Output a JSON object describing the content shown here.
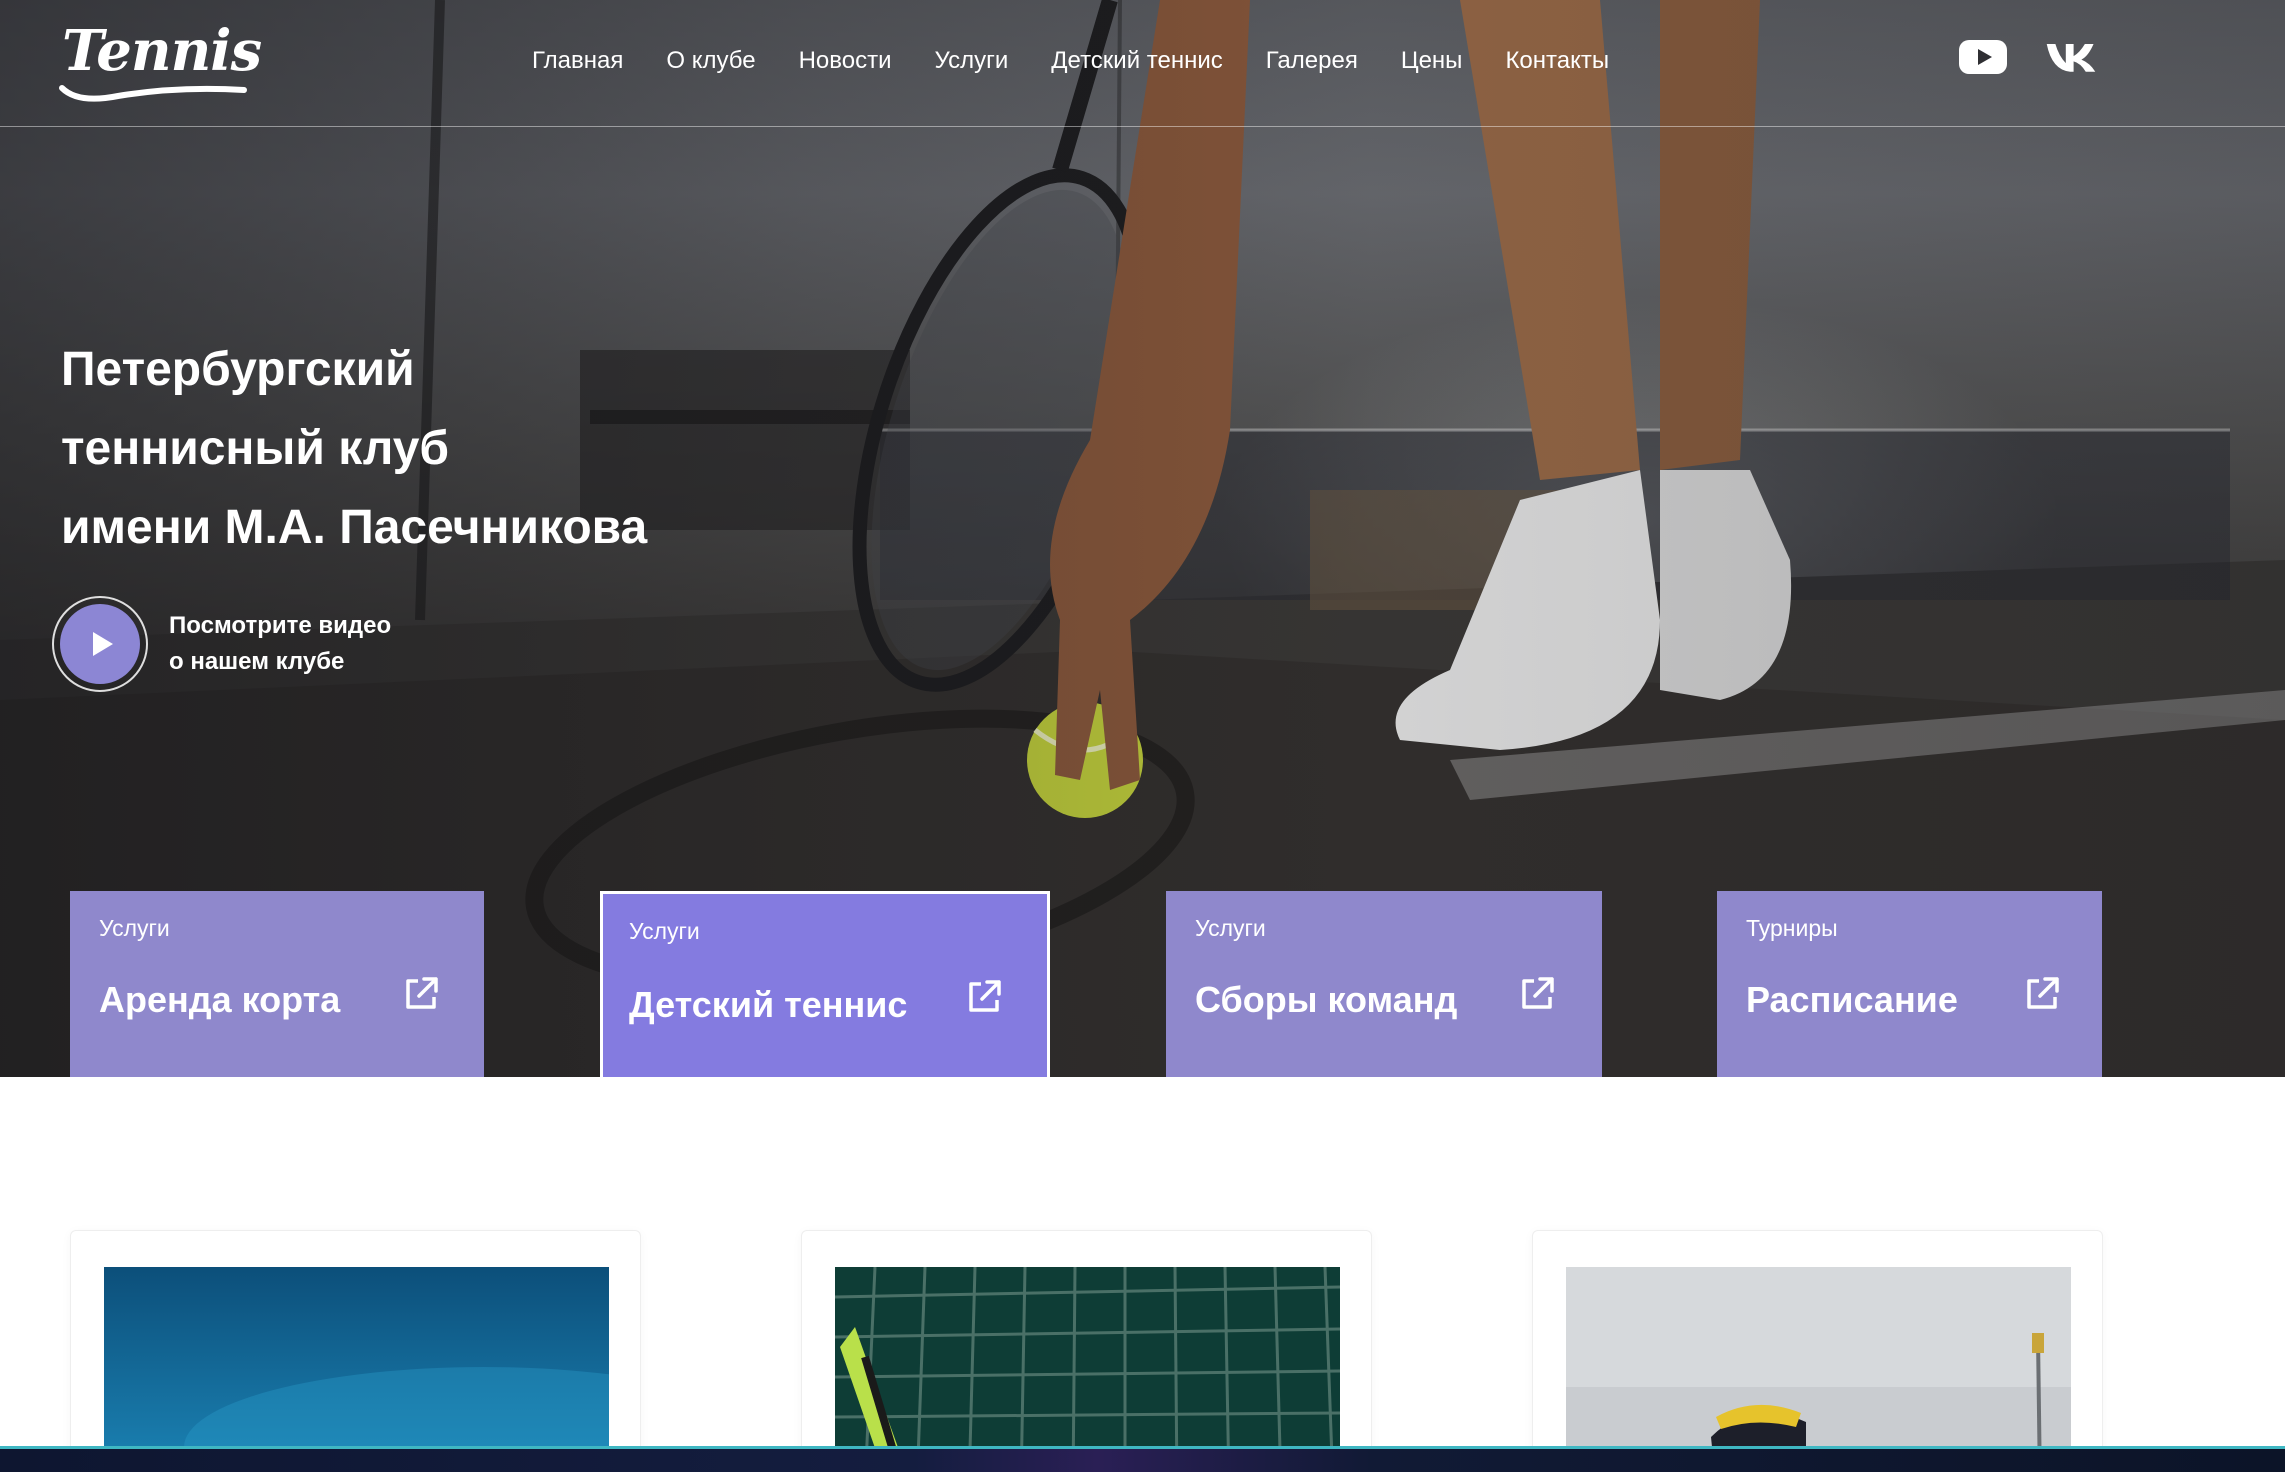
{
  "header": {
    "logo_text": "Tennis",
    "nav": [
      "Главная",
      "О клубе",
      "Новости",
      "Услуги",
      "Детский теннис",
      "Галерея",
      "Цены",
      "Контакты"
    ],
    "social": [
      {
        "icon": "youtube-icon"
      },
      {
        "icon": "vk-icon"
      }
    ]
  },
  "hero": {
    "title_lines": [
      "Петербургский",
      "теннисный клуб",
      "имени М.А. Пасечникова"
    ],
    "video_text_lines": [
      "Посмотрите видео",
      "о нашем клубе"
    ]
  },
  "cards": [
    {
      "category": "Услуги",
      "title": "Аренда корта",
      "active": false
    },
    {
      "category": "Услуги",
      "title": "Детский теннис",
      "active": true
    },
    {
      "category": "Услуги",
      "title": "Сборы команд",
      "active": false
    },
    {
      "category": "Турниры",
      "title": "Расписание",
      "active": false
    }
  ],
  "colors": {
    "card_bg": "#8f88cc",
    "card_active_bg": "#847be0",
    "play_button": "#8c86d4",
    "footer_accent": "#3fb7c3"
  }
}
